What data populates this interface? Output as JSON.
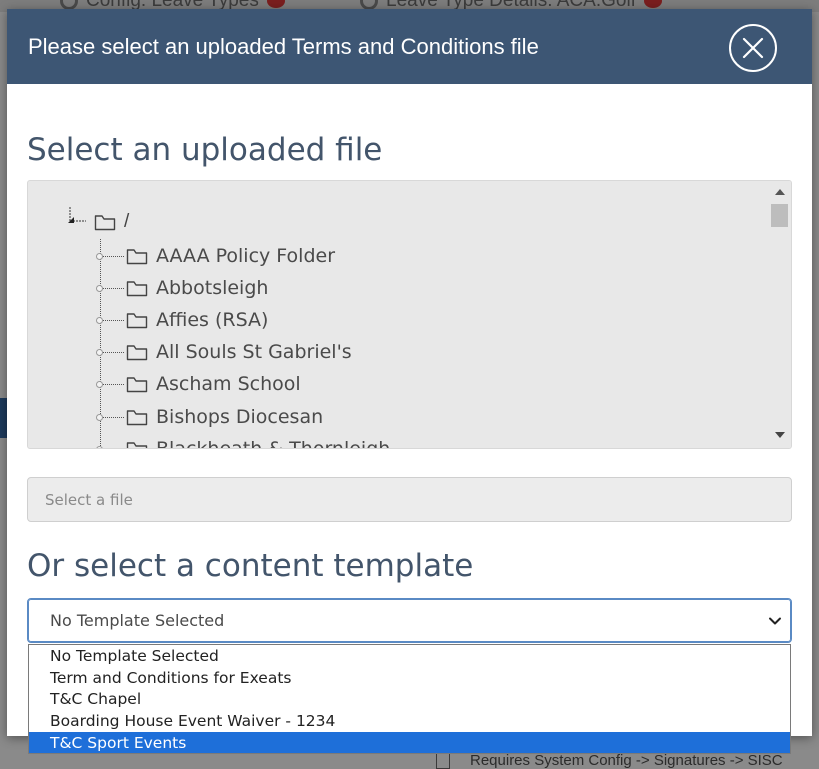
{
  "background": {
    "tabs": [
      {
        "label": "Config: Leave Types"
      },
      {
        "label": "Leave Type Details: ACA.Golf"
      }
    ],
    "footer_text": "Requires System Config -> Signatures -> SISC"
  },
  "modal": {
    "title": "Please select an uploaded Terms and Conditions file",
    "section_file_title": "Select an uploaded file",
    "tree": {
      "root": "/",
      "items": [
        {
          "label": "AAAA Policy Folder"
        },
        {
          "label": "Abbotsleigh"
        },
        {
          "label": "Affies (RSA)"
        },
        {
          "label": "All Souls St Gabriel's"
        },
        {
          "label": "Ascham School"
        },
        {
          "label": "Bishops Diocesan"
        },
        {
          "label": "Blackheath & Thornleigh"
        }
      ]
    },
    "file_input": {
      "placeholder": "Select a file",
      "value": ""
    },
    "section_template_title": "Or select a content template",
    "template_select": {
      "value": "No Template Selected",
      "options": [
        {
          "label": "No Template Selected",
          "selected": false
        },
        {
          "label": "Term and Conditions for Exeats",
          "selected": false
        },
        {
          "label": "T&C Chapel",
          "selected": false
        },
        {
          "label": "Boarding House Event Waiver - 1234",
          "selected": false
        },
        {
          "label": "T&C Sport Events",
          "selected": true
        }
      ]
    }
  },
  "colors": {
    "header_bg": "#3d5674",
    "title_text": "#43556b",
    "highlight": "#1e6fd9",
    "select_border": "#5a8ac4"
  }
}
